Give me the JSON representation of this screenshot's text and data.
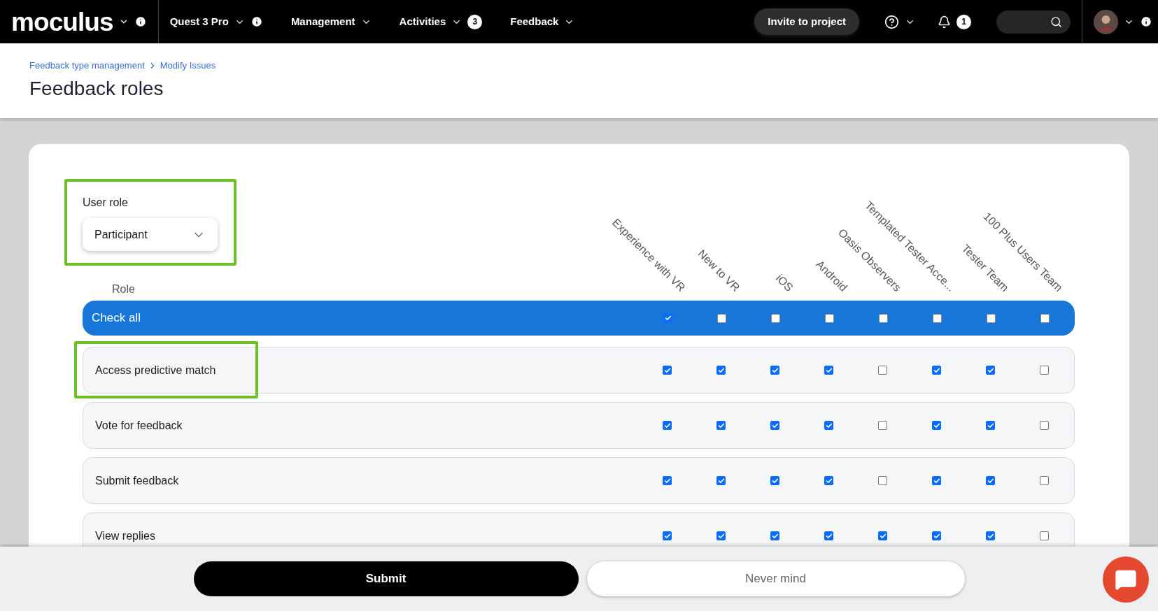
{
  "nav": {
    "logo": "moculus",
    "project": "Quest 3 Pro",
    "menus": [
      {
        "label": "Management"
      },
      {
        "label": "Activities",
        "badge": "3"
      },
      {
        "label": "Feedback"
      }
    ],
    "invite_button": "Invite to project",
    "notifications_badge": "1"
  },
  "breadcrumbs": [
    "Feedback type management",
    "Modify Issues"
  ],
  "title": "Feedback roles",
  "user_role": {
    "label": "User role",
    "value": "Participant"
  },
  "table": {
    "role_heading": "Role",
    "columns": [
      "Experience with VR",
      "New to VR",
      "iOS",
      "Android",
      "Oasis Observers",
      "Templated Tester Acce...",
      "Tester Team",
      "100 Plus Users Team"
    ],
    "check_all": {
      "label": "Check all",
      "cells": [
        {
          "checked": true
        },
        {
          "checked": false
        },
        {
          "checked": false
        },
        {
          "checked": false
        },
        {
          "checked": false
        },
        {
          "checked": false
        },
        {
          "checked": false
        },
        {
          "checked": false
        }
      ]
    },
    "rows": [
      {
        "label": "Access predictive match",
        "highlighted": true,
        "cells": [
          {
            "checked": true
          },
          {
            "checked": true
          },
          {
            "checked": true
          },
          {
            "checked": true
          },
          {
            "checked": false
          },
          {
            "checked": true
          },
          {
            "checked": true
          },
          {
            "checked": false
          }
        ]
      },
      {
        "label": "Vote for feedback",
        "highlighted": false,
        "cells": [
          {
            "checked": true
          },
          {
            "checked": true
          },
          {
            "checked": true
          },
          {
            "checked": true
          },
          {
            "checked": false
          },
          {
            "checked": true
          },
          {
            "checked": true
          },
          {
            "checked": false
          }
        ]
      },
      {
        "label": "Submit feedback",
        "highlighted": false,
        "cells": [
          {
            "checked": true
          },
          {
            "checked": true
          },
          {
            "checked": true
          },
          {
            "checked": true
          },
          {
            "checked": false
          },
          {
            "checked": true
          },
          {
            "checked": true
          },
          {
            "checked": false
          }
        ]
      },
      {
        "label": "View replies",
        "highlighted": false,
        "cells": [
          {
            "checked": true
          },
          {
            "checked": true
          },
          {
            "checked": true
          },
          {
            "checked": true
          },
          {
            "checked": true
          },
          {
            "checked": true
          },
          {
            "checked": true
          },
          {
            "checked": false
          }
        ]
      }
    ]
  },
  "footer": {
    "submit": "Submit",
    "cancel": "Never mind"
  }
}
